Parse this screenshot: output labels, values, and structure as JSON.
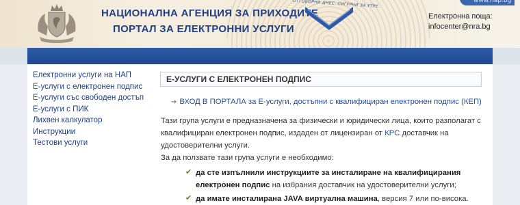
{
  "header": {
    "title_line1": "НАЦИОНАЛНА АГЕНЦИЯ ЗА ПРИХОДИТЕ",
    "title_line2": "ПОРТАЛ ЗА ЕЛЕКТРОННИ УСЛУГИ",
    "slogan": "ОТГОВОРНИ ДНЕС. СИГУРНИ ЗА УТРЕ.",
    "site": "www.nap.bg",
    "contact_label": "Електронна поща:",
    "contact_email": "infocenter@nra.bg"
  },
  "sidebar": {
    "items": [
      {
        "label": "Електронни услуги на НАП"
      },
      {
        "label": "Е-услуги с електронен подпис"
      },
      {
        "label": "Е-услуги със свободен достъп"
      },
      {
        "label": "Е-услуги с ПИК"
      },
      {
        "label": "Лихвен калкулатор"
      },
      {
        "label": "Инструкции"
      },
      {
        "label": "Тестови услуги"
      }
    ]
  },
  "main": {
    "section_title": "Е-УСЛУГИ С ЕЛЕКТРОНЕН ПОДПИС",
    "login_link": "ВХОД В ПОРТАЛА за Е-услуги, достъпни с квалифициран електронен подпис (КЕП)",
    "para1_a": "Тази група услуги е предназначена за физически и юридически лица, които разполагат с квалифициран електронен подпис, издаден от лицензиран от ",
    "para1_link": "КРС",
    "para1_b": " доставчик на удостоверителни услуги.",
    "para2": "За да ползвате тази група услуги е необходимо:",
    "req1_bold": "да сте изпълнили инструкциите за инсталиране на квалифицирания електронен подпис",
    "req1_rest": " на избрания доставчик на удостоверителни услуги;",
    "req2_bold": "да имате инсталирана JAVA виртуална машина",
    "req2_rest": ", версия 7 или по-висока."
  },
  "colors": {
    "brand_blue": "#1f3f86",
    "bar_blue": "#2a56a0",
    "link_blue": "#1f4d9c"
  }
}
